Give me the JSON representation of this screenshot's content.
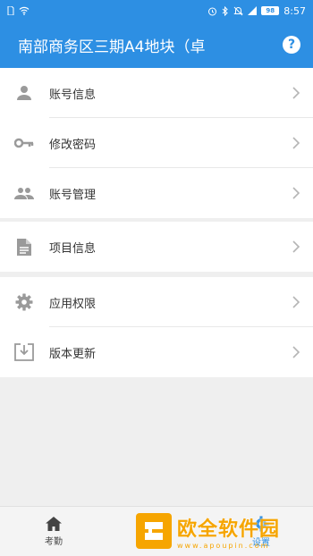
{
  "status_bar": {
    "battery": "98",
    "time": "8:57"
  },
  "header": {
    "title": "南部商务区三期A4地块（卓",
    "help_symbol": "?"
  },
  "groups": [
    {
      "items": [
        {
          "label": "账号信息",
          "icon": "person-icon"
        },
        {
          "label": "修改密码",
          "icon": "key-icon"
        },
        {
          "label": "账号管理",
          "icon": "people-icon"
        }
      ]
    },
    {
      "items": [
        {
          "label": "项目信息",
          "icon": "document-icon"
        }
      ]
    },
    {
      "items": [
        {
          "label": "应用权限",
          "icon": "gear-icon"
        },
        {
          "label": "版本更新",
          "icon": "download-icon"
        }
      ]
    }
  ],
  "tab_bar": {
    "tabs": [
      {
        "label": "考勤",
        "icon": "home-icon",
        "active": false
      },
      {
        "label": "设置",
        "icon": "gear-icon",
        "active": true
      }
    ]
  },
  "watermark": {
    "text": "欧全软件园",
    "url": "www.apoupin.com"
  },
  "colors": {
    "primary": "#2d8fe3",
    "icon_gray": "#9a9a9a",
    "watermark": "#f6a500"
  }
}
